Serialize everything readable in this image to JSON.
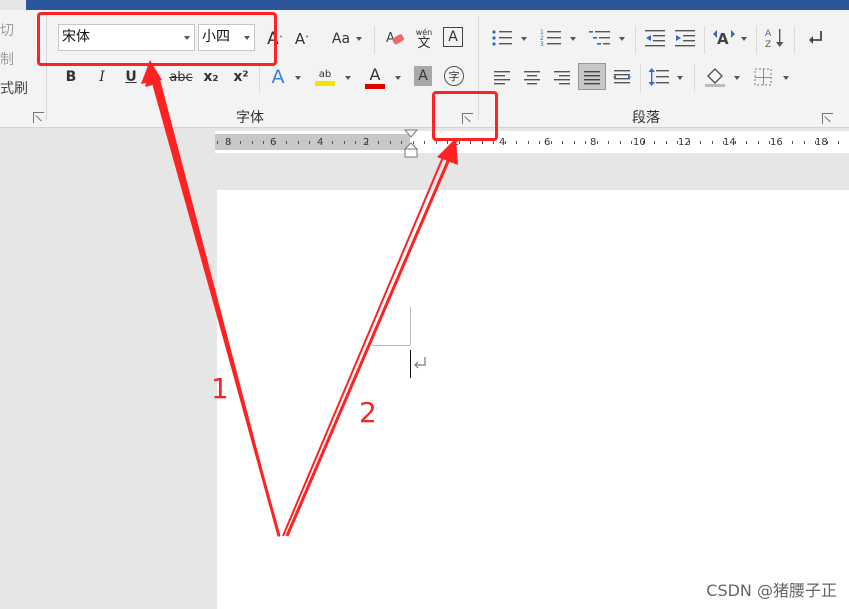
{
  "clipboard": {
    "cut": "切",
    "copy": "制",
    "format_painter": "式刷"
  },
  "font_group": {
    "font_name": "宋体",
    "font_size": "小四",
    "label": "字体",
    "bold": "B",
    "italic": "I",
    "underline": "U",
    "strike": "abc",
    "sub": "x₂",
    "sup": "x²",
    "case": "Aa",
    "phonetic_top": "wén",
    "phonetic_bottom": "文",
    "border_char": "A",
    "font_color": "A",
    "shade": "A",
    "enclose": "字"
  },
  "paragraph_group": {
    "label": "段落"
  },
  "ruler": {
    "ticks": [
      "8",
      "6",
      "4",
      "2",
      "2",
      "4",
      "6",
      "8",
      "10",
      "12",
      "14",
      "16",
      "18"
    ]
  },
  "annotations": {
    "label_1": "1",
    "label_2": "2",
    "color": "#ff2222"
  },
  "watermark": "CSDN @猪腰子正"
}
